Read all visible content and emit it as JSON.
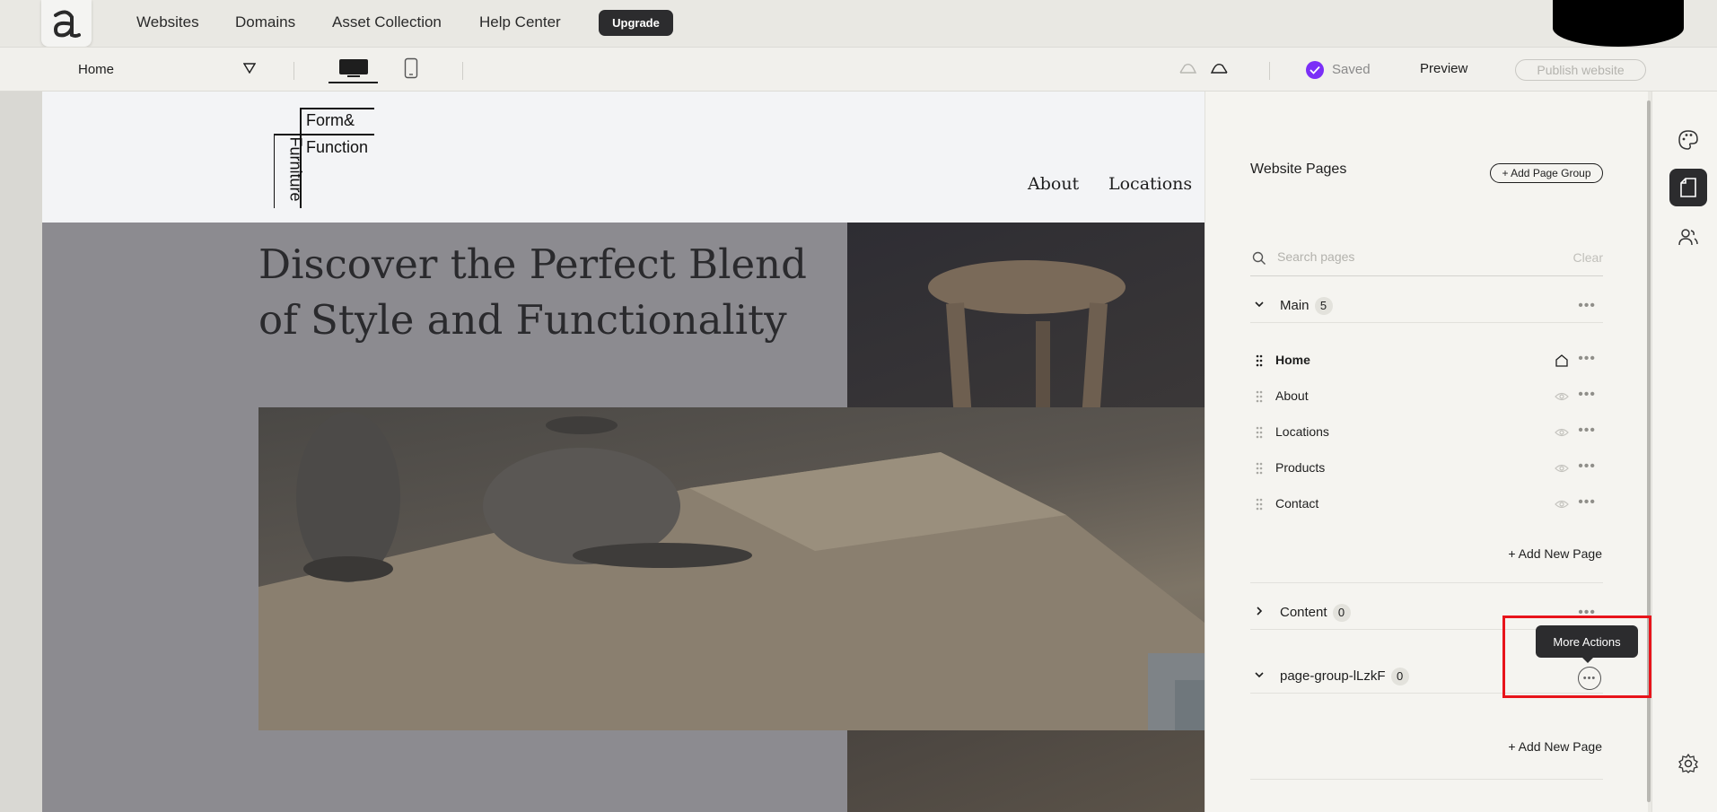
{
  "topnav": {
    "logo_letter": "a",
    "links": [
      "Websites",
      "Domains",
      "Asset Collection",
      "Help Center"
    ],
    "upgrade_label": "Upgrade"
  },
  "toolbar": {
    "current_page": "Home",
    "saved_label": "Saved",
    "preview_label": "Preview",
    "publish_label": "Publish website"
  },
  "site": {
    "brand": {
      "line1": "Form&",
      "line2": "Function",
      "vertical": "Furniture"
    },
    "nav": [
      "About",
      "Locations"
    ],
    "hero_title": "Discover the Perfect Blend of Style and Functionality"
  },
  "panel": {
    "title": "Website Pages",
    "add_group_label": "+ Add Page Group",
    "search_placeholder": "Search pages",
    "search_clear": "Clear",
    "groups": [
      {
        "name": "Main",
        "count": "5",
        "expanded": true
      },
      {
        "name": "Content",
        "count": "0",
        "expanded": false
      },
      {
        "name": "page-group-lLzkF",
        "count": "0",
        "expanded": true
      }
    ],
    "pages": [
      {
        "label": "Home",
        "icon": "home-icon"
      },
      {
        "label": "About",
        "icon": "eye-icon"
      },
      {
        "label": "Locations",
        "icon": "eye-icon"
      },
      {
        "label": "Products",
        "icon": "eye-icon"
      },
      {
        "label": "Contact",
        "icon": "eye-icon"
      }
    ],
    "add_page_label": "+ Add New Page",
    "tooltip": "More Actions"
  },
  "colors": {
    "accent_purple": "#7b2ff7",
    "dark": "#2c2c2e",
    "highlight_red": "#e8141b"
  }
}
